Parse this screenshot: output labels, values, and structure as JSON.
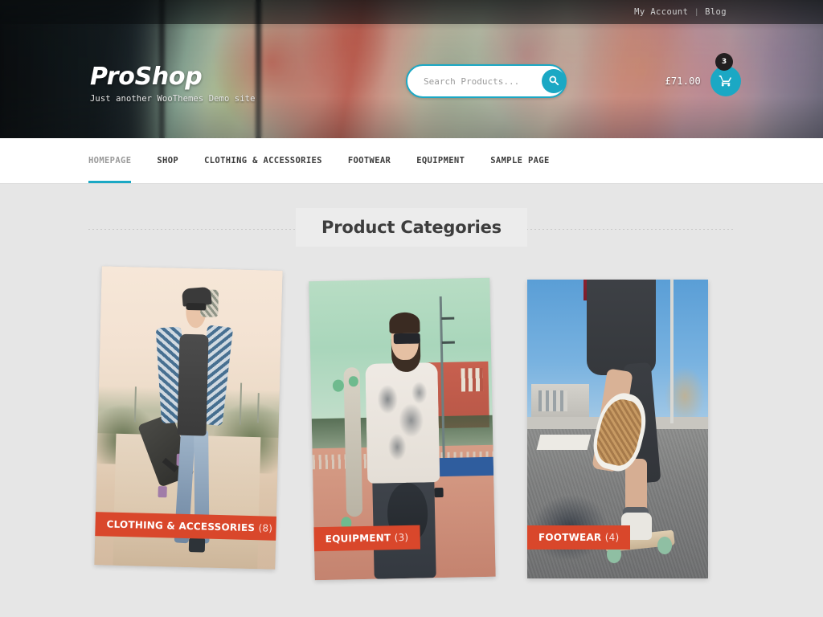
{
  "topbar": {
    "links": [
      {
        "label": "My Account"
      },
      {
        "label": "Blog"
      }
    ],
    "separator": "|"
  },
  "branding": {
    "name": "ProShop",
    "tagline": "Just another WooThemes Demo site"
  },
  "search": {
    "placeholder": "Search Products...",
    "value": "",
    "icon": "search-icon"
  },
  "cart": {
    "total": "£71.00",
    "item_count": "3",
    "icon": "shopping-cart-icon"
  },
  "nav": {
    "items": [
      {
        "label": "HOMEPAGE",
        "active": true
      },
      {
        "label": "SHOP",
        "active": false
      },
      {
        "label": "CLOTHING & ACCESSORIES",
        "active": false
      },
      {
        "label": "FOOTWEAR",
        "active": false
      },
      {
        "label": "EQUIPMENT",
        "active": false
      },
      {
        "label": "SAMPLE PAGE",
        "active": false
      }
    ]
  },
  "main": {
    "section_title": "Product Categories",
    "categories": [
      {
        "name": "CLOTHING & ACCESSORIES",
        "count": "(8)"
      },
      {
        "name": "EQUIPMENT",
        "count": "(3)"
      },
      {
        "name": "FOOTWEAR",
        "count": "(4)"
      }
    ]
  },
  "colors": {
    "accent_teal": "#1ba8c4",
    "label_orange": "#d9472b",
    "page_background": "#e6e6e6",
    "nav_background": "#ffffff",
    "badge_dark": "#231f20"
  }
}
